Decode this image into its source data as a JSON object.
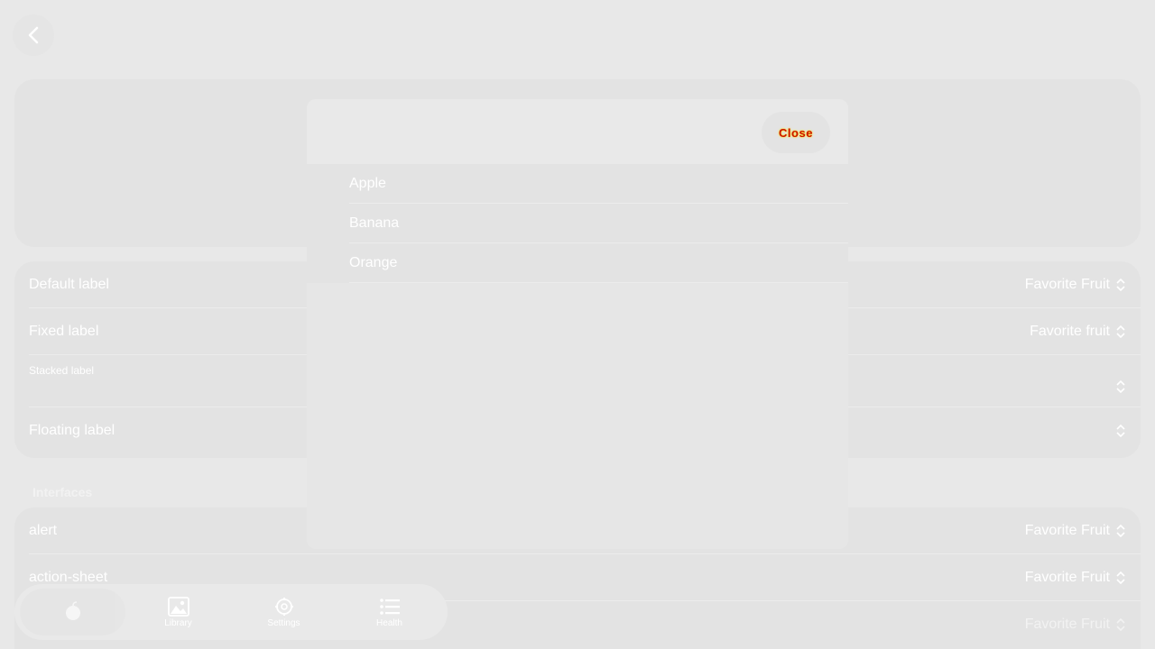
{
  "header": {
    "back_icon": "chevron-left-icon"
  },
  "labels_list": {
    "rows": [
      {
        "label": "Default label",
        "value": "Favorite Fruit"
      },
      {
        "label": "Fixed label",
        "value": "Favorite fruit"
      },
      {
        "label": "Stacked label",
        "value": ""
      },
      {
        "label": "Floating label",
        "value": ""
      }
    ]
  },
  "interfaces": {
    "header": "Interfaces",
    "rows": [
      {
        "label": "alert",
        "value": "Favorite Fruit"
      },
      {
        "label": "action-sheet",
        "value": "Favorite Fruit"
      },
      {
        "label": "",
        "value": "Favorite Fruit"
      }
    ]
  },
  "modal": {
    "close_label": "Close",
    "options": [
      "Apple",
      "Banana",
      "Orange"
    ]
  },
  "tabbar": {
    "tabs": [
      {
        "label": "",
        "icon": "fruit-icon"
      },
      {
        "label": "Library",
        "icon": "images-icon"
      },
      {
        "label": "Settings",
        "icon": "gear-icon"
      },
      {
        "label": "Health",
        "icon": "list-icon"
      }
    ]
  },
  "colors": {
    "background": "#e8e8e8",
    "card": "#e3e3e3",
    "close_text": "#cc1100",
    "close_glow": "#ffdd00"
  }
}
